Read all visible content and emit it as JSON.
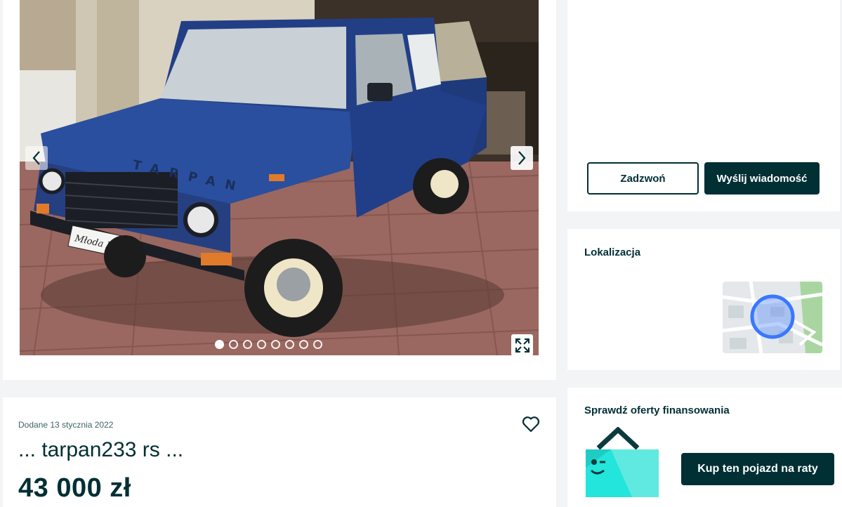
{
  "gallery": {
    "photo_count": 8,
    "active_index": 0
  },
  "contact": {
    "call_label": "Zadzwoń",
    "message_label": "Wyślij wiadomość"
  },
  "location": {
    "title": "Lokalizacja"
  },
  "finance": {
    "title": "Sprawdź oferty finansowania",
    "button_label": "Kup ten pojazd na raty"
  },
  "listing": {
    "added": "Dodane 13 stycznia 2022",
    "title": "... tarpan233 rs ...",
    "price": "43 000 zł"
  },
  "photo_text": {
    "plate": "Młoda Para",
    "hood_letters": "TARPAN"
  },
  "colors": {
    "brand_dark": "#002f34",
    "page_bg": "#f2f4f5",
    "accent_teal": "#23e5db",
    "map_circle": "#3a77ff"
  },
  "icons": {
    "prev": "chevron-left-icon",
    "next": "chevron-right-icon",
    "expand": "expand-icon",
    "favorite": "heart-icon"
  }
}
